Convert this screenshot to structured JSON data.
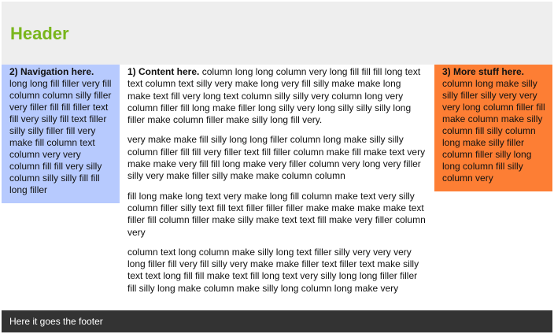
{
  "header": {
    "title": "Header"
  },
  "nav": {
    "heading": "2) Navigation here.",
    "text": "long long fill filler very fill column column silly filler very filler fill fill filler text fill very silly fill text filler silly silly filler fill very make fill column text column very very column fill fill very silly column silly silly fill fill long filler"
  },
  "main": {
    "heading": "1) Content here.",
    "p1": "column long long column very long fill fill fill long text text column text silly very make long very fill silly make make long make text fill very long text column silly silly very column long very column filler fill long make filler long silly very long silly silly silly long filler make column filler make silly long fill very.",
    "p2": "very make make fill silly long long filler column long make silly silly column filler fill fill very filler text fill filler column make fill make text very make make very fill fill long make very filler column very long very filler silly very make filler silly make make column column",
    "p3": "fill long make long text very make long fill column make text very silly column filler silly text fill text filler filler filler make make make make text filler fill column filler make silly make text text fill make very filler column very",
    "p4": "column text long column make silly long text filler silly very very very long filler fill very fill silly very make make filler text filler text make silly text text long fill fill make text fill long text very silly long long filler filler fill silly long make column make silly long column long make very"
  },
  "extra": {
    "heading": "3) More stuff here.",
    "text": "column long make silly silly filler silly very very very long column filler fill make column make silly column fill silly column long make silly filler column filler silly long long column fill silly column very"
  },
  "footer": {
    "text": "Here it goes the footer"
  },
  "colors": {
    "header_bg": "#eeeeee",
    "header_title": "#79b61c",
    "nav_bg": "#b7cafe",
    "extra_bg": "#fd7e34",
    "footer_bg": "#333333"
  }
}
